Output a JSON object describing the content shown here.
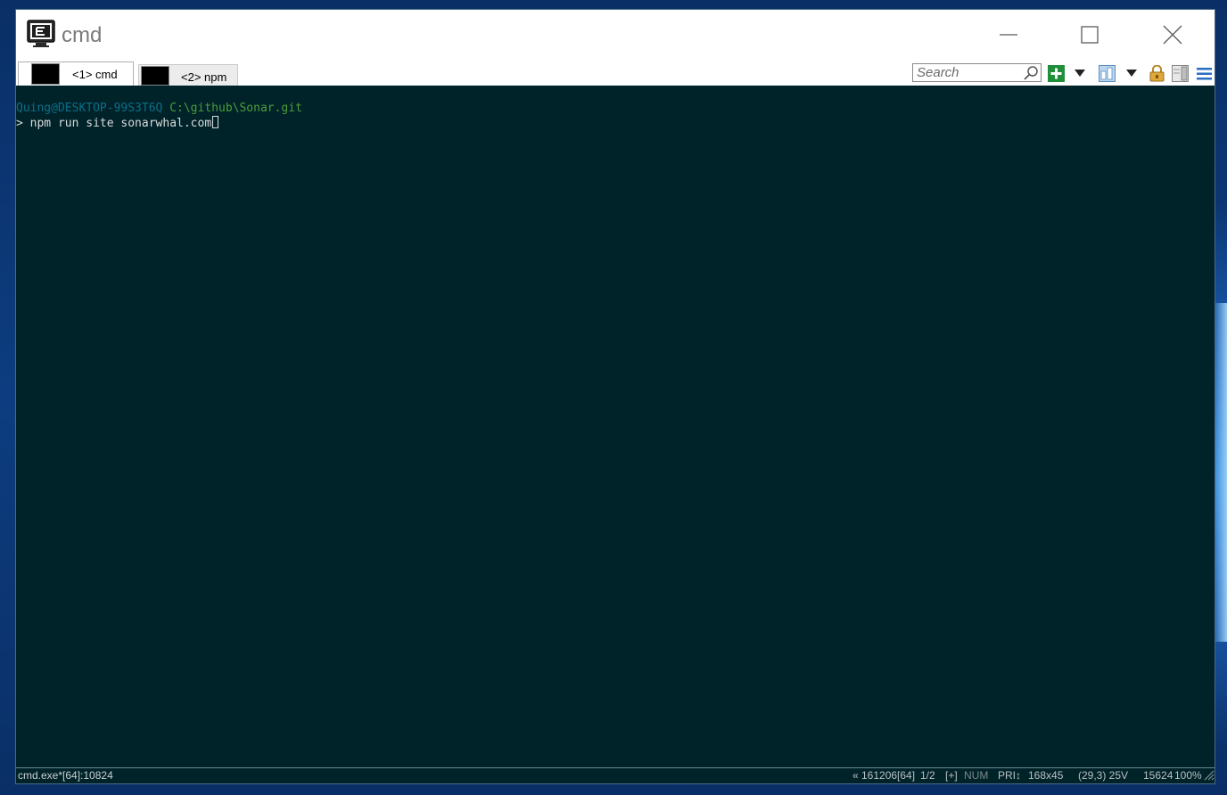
{
  "window": {
    "title": "cmd"
  },
  "tabs": [
    {
      "label": "<1> cmd"
    },
    {
      "label": "<2> npm"
    }
  ],
  "toolbar": {
    "search_placeholder": "Search",
    "icons": [
      "search-icon",
      "new-console-icon",
      "dropdown-arrow-icon",
      "split-panes-icon",
      "dropdown-arrow-icon",
      "lock-icon",
      "panel-icon",
      "menu-icon"
    ]
  },
  "console": {
    "prompt_user": "Quing@DESKTOP-99S3T6Q",
    "prompt_path": "C:\\github\\Sonar.git",
    "prompt_symbol": ">",
    "command": "npm run site sonarwhal.com"
  },
  "status": {
    "process": "cmd.exe*[64]:10824",
    "position": "« 161206[64]",
    "pane": "1/2",
    "plus": "[+]",
    "num": "NUM",
    "pri": "PRI↕",
    "size": "168x45",
    "cursor": "(29,3) 25V",
    "pid": "15624",
    "zoom": "100%"
  },
  "colors": {
    "console_bg": "#002229",
    "user": "#0a6f8a",
    "path": "#4c9e3a",
    "text": "#d8dcdc"
  }
}
